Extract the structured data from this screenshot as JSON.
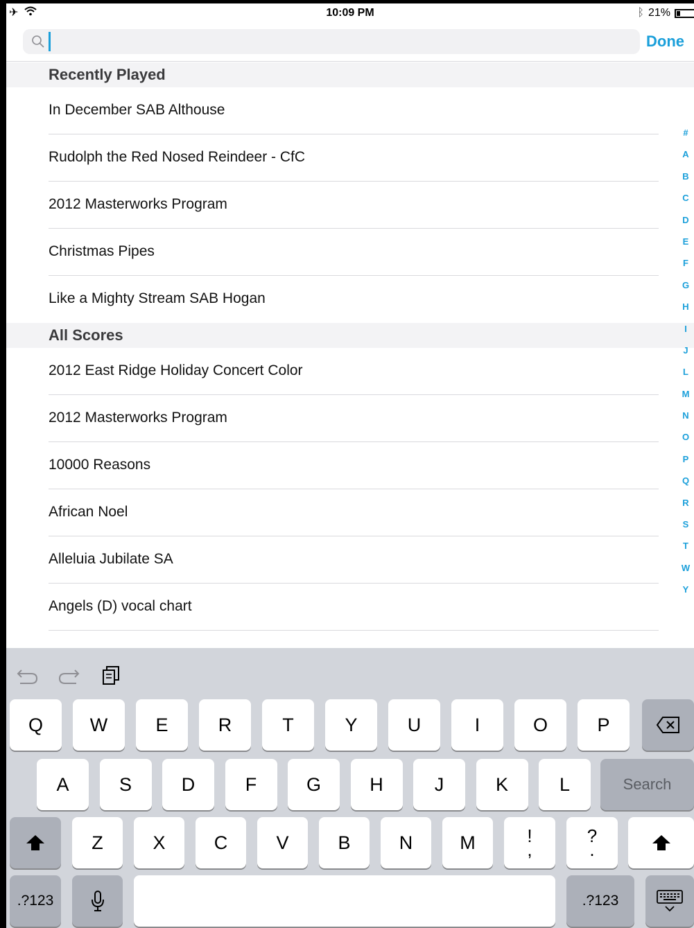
{
  "status": {
    "time": "10:09 PM",
    "battery": "21%",
    "battery_level": 0.21,
    "icons": [
      "airplane-icon",
      "wifi-icon",
      "bluetooth-icon",
      "battery-icon"
    ]
  },
  "search": {
    "value": "",
    "done_label": "Done"
  },
  "sections": {
    "recent": {
      "title": "Recently Played",
      "items": [
        "In December SAB Althouse",
        "Rudolph the Red Nosed Reindeer - CfC",
        "2012 Masterworks Program",
        "Christmas Pipes",
        "Like a Mighty Stream SAB Hogan"
      ]
    },
    "all": {
      "title": "All Scores",
      "items": [
        "2012 East Ridge Holiday Concert Color",
        "2012 Masterworks Program",
        "10000 Reasons",
        "African Noel",
        "Alleluia Jubilate SA",
        "Angels (D) vocal chart"
      ]
    }
  },
  "index_letters": [
    "#",
    "A",
    "B",
    "C",
    "D",
    "E",
    "F",
    "G",
    "H",
    "I",
    "J",
    "L",
    "M",
    "N",
    "O",
    "P",
    "Q",
    "R",
    "S",
    "T",
    "W",
    "Y"
  ],
  "keyboard": {
    "row1": [
      "Q",
      "W",
      "E",
      "R",
      "T",
      "Y",
      "U",
      "I",
      "O",
      "P"
    ],
    "row2": [
      "A",
      "S",
      "D",
      "F",
      "G",
      "H",
      "J",
      "K",
      "L"
    ],
    "search_label": "Search",
    "row3": [
      "Z",
      "X",
      "C",
      "V",
      "B",
      "N",
      "M"
    ],
    "punct1_top": "!",
    "punct1_bottom": ",",
    "punct2_top": "?",
    "punct2_bottom": ".",
    "numbers_label": ".?123",
    "accent_color": "#1a9fda"
  }
}
